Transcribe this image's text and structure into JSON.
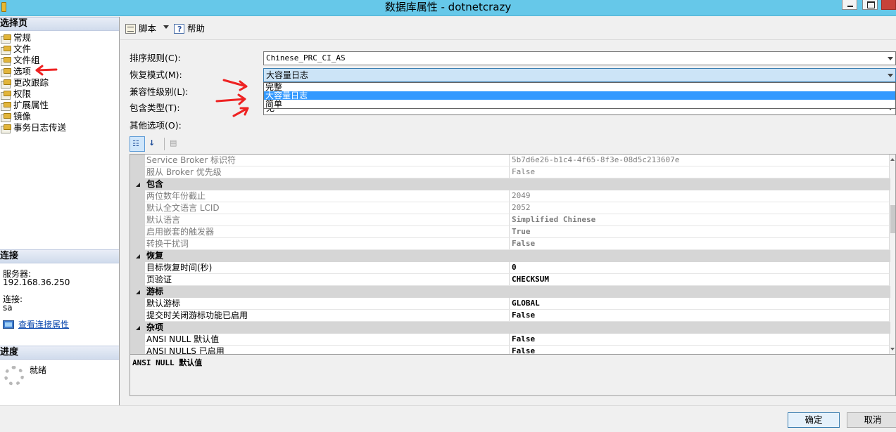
{
  "window": {
    "title": "数据库属性 - dotnetcrazy"
  },
  "left_panel": {
    "select_page_header": "选择页",
    "pages": [
      {
        "label": "常规",
        "icon": "settings-page-icon"
      },
      {
        "label": "文件",
        "icon": "settings-page-icon"
      },
      {
        "label": "文件组",
        "icon": "settings-page-icon"
      },
      {
        "label": "选项",
        "icon": "settings-page-icon"
      },
      {
        "label": "更改跟踪",
        "icon": "settings-page-icon"
      },
      {
        "label": "权限",
        "icon": "settings-page-icon"
      },
      {
        "label": "扩展属性",
        "icon": "settings-page-icon"
      },
      {
        "label": "镜像",
        "icon": "settings-page-icon"
      },
      {
        "label": "事务日志传送",
        "icon": "settings-page-icon"
      }
    ],
    "connection_header": "连接",
    "server_label": "服务器:",
    "server_value": "192.168.36.250",
    "connection_label": "连接:",
    "connection_value": "sa",
    "view_connection_link": "查看连接属性",
    "progress_header": "进度",
    "progress_status": "就绪"
  },
  "toolbar": {
    "script_label": "脚本",
    "help_label": "帮助"
  },
  "form": {
    "collation_label": "排序规则(C):",
    "collation_value": "Chinese_PRC_CI_AS",
    "recovery_label": "恢复模式(M):",
    "recovery_value": "大容量日志",
    "recovery_options": [
      "完整",
      "大容量日志",
      "简单"
    ],
    "recovery_selected_index": 1,
    "compat_label": "兼容性级别(L):",
    "containment_label": "包含类型(T):",
    "containment_value": "无",
    "other_options_label": "其他选项(O):"
  },
  "property_grid": {
    "rows": [
      {
        "kind": "prop",
        "name": "Service Broker 标识符",
        "value": "5b7d6e26-b1c4-4f65-8f3e-08d5c213607e",
        "disabled": true,
        "bold": false
      },
      {
        "kind": "prop",
        "name": "服从 Broker 优先级",
        "value": "False",
        "disabled": true,
        "bold": false
      },
      {
        "kind": "cat",
        "name": "包含"
      },
      {
        "kind": "prop",
        "name": "两位数年份截止",
        "value": "2049",
        "disabled": true,
        "bold": false
      },
      {
        "kind": "prop",
        "name": "默认全文语言 LCID",
        "value": "2052",
        "disabled": true,
        "bold": false
      },
      {
        "kind": "prop",
        "name": "默认语言",
        "value": "Simplified Chinese",
        "disabled": true,
        "bold": true
      },
      {
        "kind": "prop",
        "name": "启用嵌套的触发器",
        "value": "True",
        "disabled": true,
        "bold": true
      },
      {
        "kind": "prop",
        "name": "转换干扰词",
        "value": "False",
        "disabled": true,
        "bold": true
      },
      {
        "kind": "cat",
        "name": "恢复"
      },
      {
        "kind": "prop",
        "name": "目标恢复时间(秒)",
        "value": "0",
        "disabled": false,
        "bold": true
      },
      {
        "kind": "prop",
        "name": "页验证",
        "value": "CHECKSUM",
        "disabled": false,
        "bold": true
      },
      {
        "kind": "cat",
        "name": "游标"
      },
      {
        "kind": "prop",
        "name": "默认游标",
        "value": "GLOBAL",
        "disabled": false,
        "bold": true
      },
      {
        "kind": "prop",
        "name": "提交时关闭游标功能已启用",
        "value": "False",
        "disabled": false,
        "bold": true
      },
      {
        "kind": "cat",
        "name": "杂项"
      },
      {
        "kind": "prop",
        "name": "ANSI NULL 默认值",
        "value": "False",
        "disabled": false,
        "bold": true
      },
      {
        "kind": "prop",
        "name": "ANSI NULLS 已启用",
        "value": "False",
        "disabled": false,
        "bold": true
      }
    ],
    "description_title": "ANSI NULL 默认值"
  },
  "footer": {
    "ok_label": "确定",
    "cancel_label": "取消"
  },
  "colors": {
    "titlebar": "#66c8e9",
    "dropdown_selection": "#3399ff",
    "annotation_arrow": "#ee2222"
  }
}
